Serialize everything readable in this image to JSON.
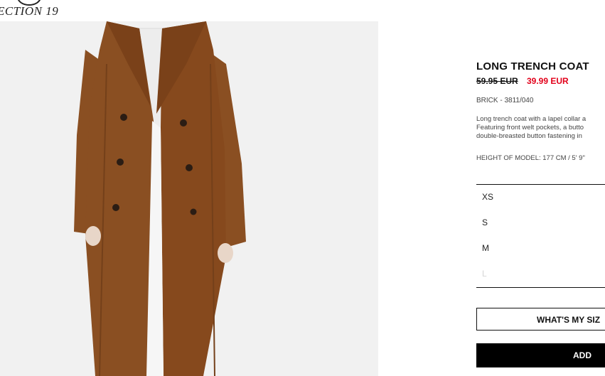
{
  "header": {
    "collection_label": "ECTION 19"
  },
  "product": {
    "name": "LONG TRENCH COAT",
    "price_original": "59.95 EUR",
    "price_sale": "39.99 EUR",
    "sale_color": "#e2001a",
    "color_ref": "BRICK - 3811/040",
    "description_lines": [
      "Long trench coat with a lapel collar a",
      "Featuring front welt pockets, a butto",
      "double-breasted button fastening in"
    ],
    "model_height": "HEIGHT OF MODEL: 177 CM / 5' 9\""
  },
  "sizes": [
    {
      "label": "XS",
      "available": true
    },
    {
      "label": "S",
      "available": true
    },
    {
      "label": "M",
      "available": true
    },
    {
      "label": "L",
      "available": false
    }
  ],
  "actions": {
    "size_guide_label": "WHAT'S MY SIZ",
    "add_label": "ADD"
  },
  "image": {
    "icon": "product-photo-trench-coat",
    "coat_color": "#8a4f22",
    "background": "#f1f1f1"
  }
}
